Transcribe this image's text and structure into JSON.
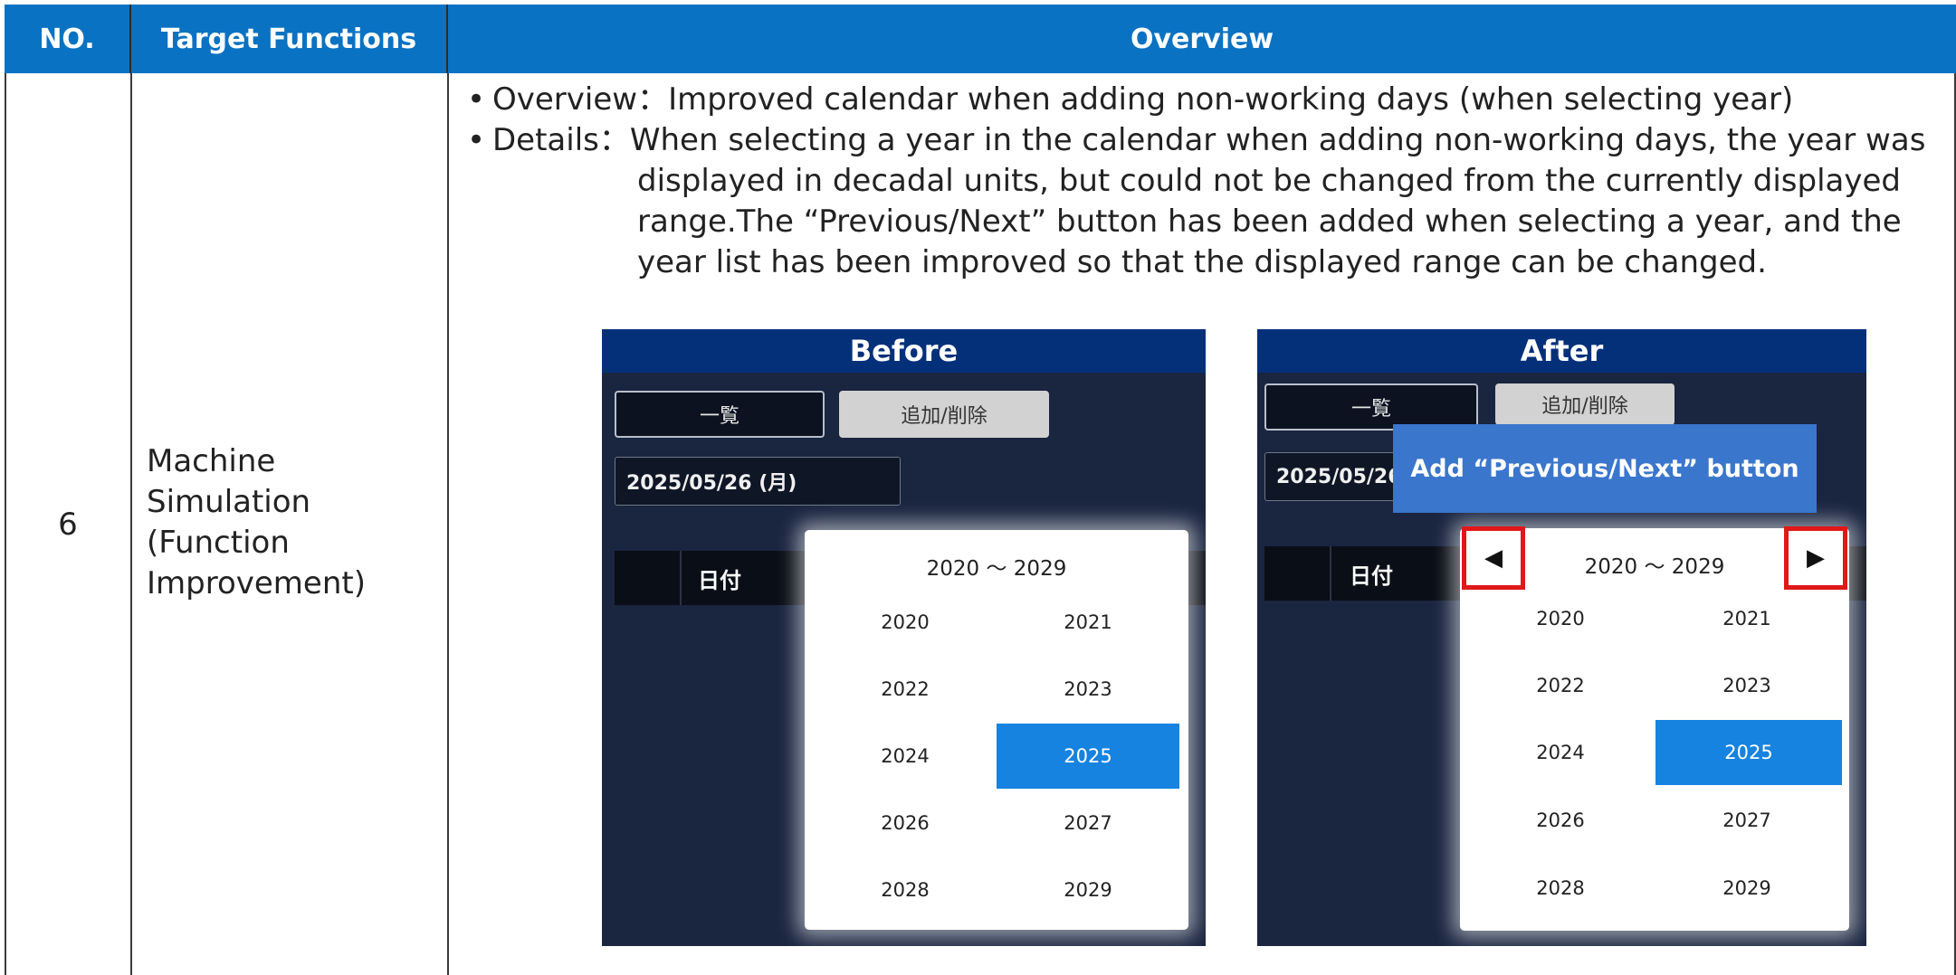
{
  "table": {
    "headers": [
      "NO.",
      "Target Functions",
      "Overview"
    ],
    "no": "6",
    "target_function_lines": [
      "Machine",
      "Simulation",
      "(Function",
      "Improvement)"
    ]
  },
  "overview": {
    "bullet": "•",
    "overview_label": "Overview：",
    "overview_text": "Improved calendar when adding non-working days (when selecting year)",
    "details_label": "Details：",
    "details_lines": [
      "When selecting a year in the calendar when adding non-working days, the year was",
      "displayed in decadal units, but could not be changed from the currently displayed",
      "range.The “Previous/Next” button has been added when selecting a year, and the",
      "year list has been improved so that the displayed range can be changed."
    ]
  },
  "before": {
    "title": "Before",
    "list_button": "一覧",
    "add_delete_button": "追加/削除",
    "date_value": "2025/05/26 (月)",
    "date_header": "日付",
    "range_label": "2020 ～ 2029",
    "years": [
      "2020",
      "2021",
      "2022",
      "2023",
      "2024",
      "2025",
      "2026",
      "2027",
      "2028",
      "2029"
    ],
    "selected_year": "2025"
  },
  "after": {
    "title": "After",
    "list_button": "一覧",
    "add_delete_button": "追加/削除",
    "date_value": "2025/05/26",
    "date_header": "日付",
    "range_label": "2020 ～ 2029",
    "prev_glyph": "◀",
    "next_glyph": "▶",
    "years": [
      "2020",
      "2021",
      "2022",
      "2023",
      "2024",
      "2025",
      "2026",
      "2027",
      "2028",
      "2029"
    ],
    "selected_year": "2025",
    "callout": "Add “Previous/Next” button"
  },
  "colors": {
    "header_blue": "#0a72c2",
    "panel_title": "#04307a",
    "selected_year": "#1683e0",
    "highlight_red": "#e01818",
    "callout_blue": "#3a76cc"
  }
}
